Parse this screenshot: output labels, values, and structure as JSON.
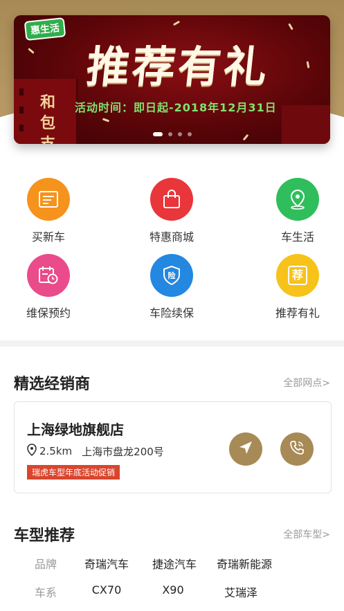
{
  "banner": {
    "logo": "惠生活",
    "headline": "推荐有礼",
    "subline": "活动时间：即日起-2018年12月31日",
    "side_text": "和包支",
    "dots": 4,
    "active_dot": 1
  },
  "features": [
    {
      "label": "买新车",
      "icon": "document-icon",
      "color": "#f5931d"
    },
    {
      "label": "特惠商城",
      "icon": "shopping-bag-icon",
      "color": "#e8363a"
    },
    {
      "label": "车生活",
      "icon": "map-pin-icon",
      "color": "#2fbe5b"
    },
    {
      "label": "维保预约",
      "icon": "calendar-clock-icon",
      "color": "#ea4b8b"
    },
    {
      "label": "车险续保",
      "icon": "shield-icon",
      "color": "#2487e0",
      "glyph": "险"
    },
    {
      "label": "推荐有礼",
      "icon": "recommend-icon",
      "color": "#f7c21a",
      "glyph": "荐"
    }
  ],
  "dealers_section": {
    "title": "精选经销商",
    "more": "全部网点>"
  },
  "dealer": {
    "name": "上海绿地旗舰店",
    "distance": "2.5km",
    "address": "上海市盘龙200号",
    "promo": "瑞虎车型年底活动促销",
    "navigate_icon": "navigation-arrow-icon",
    "phone_icon": "phone-icon",
    "button_color": "#a78a55"
  },
  "models_section": {
    "title": "车型推荐",
    "more": "全部车型>",
    "rows": [
      {
        "key": "品牌",
        "values": [
          "奇瑞汽车",
          "捷途汽车",
          "奇瑞新能源"
        ]
      },
      {
        "key": "车系",
        "values": [
          "CX70",
          "X90",
          "艾瑞泽"
        ]
      }
    ]
  }
}
